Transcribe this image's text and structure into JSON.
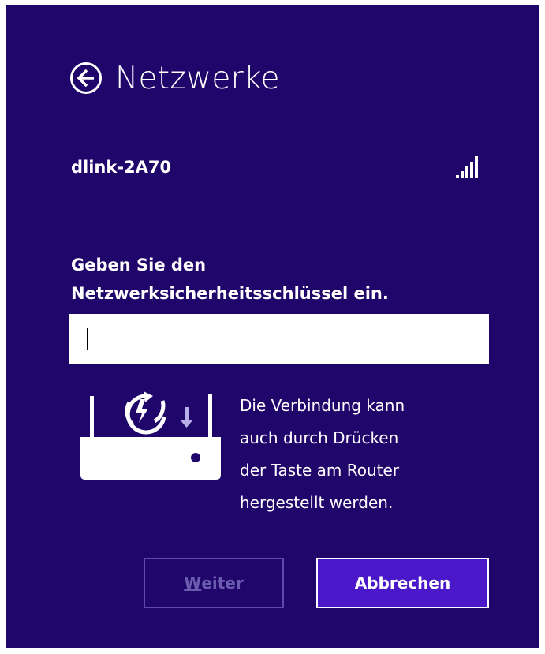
{
  "window": {
    "title": "Netzwerke",
    "background_color": "#20056a"
  },
  "network": {
    "name": "dlink-2A70",
    "signal_icon": "wifi-signal-full-icon"
  },
  "prompt": {
    "line1": "Geben Sie den",
    "line2": "Netzwerksicherheitsschlüssel ein."
  },
  "key_input": {
    "value": "",
    "placeholder": ""
  },
  "wps": {
    "icon": "router-wps-icon",
    "line1": "Die Verbindung kann",
    "line2": "auch durch Drücken",
    "line3": "der Taste am Router",
    "line4": "hergestellt werden."
  },
  "buttons": {
    "next_label_first": "W",
    "next_label_rest": "eiter",
    "cancel_label": "Abbrechen"
  },
  "colors": {
    "accent": "#4a18c8",
    "disabled": "#5a4ba6"
  }
}
